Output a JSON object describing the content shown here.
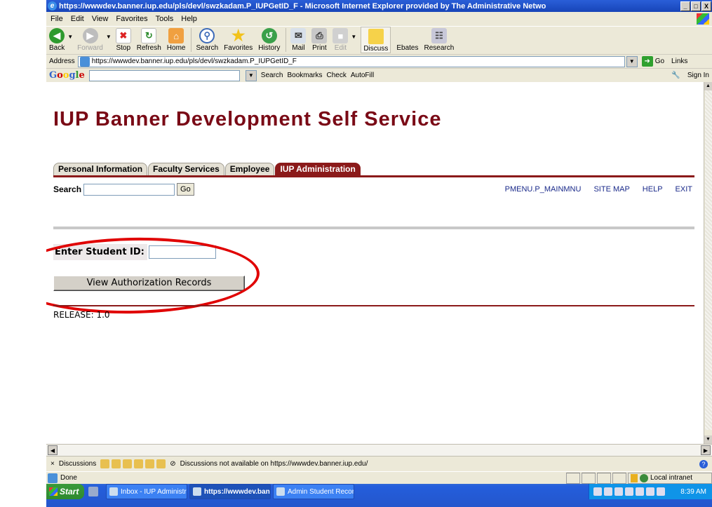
{
  "window": {
    "title": "https://wwwdev.banner.iup.edu/pls/devl/swzkadam.P_IUPGetID_F - Microsoft Internet Explorer provided by The Administrative Netwo",
    "min": "_",
    "max": "□",
    "close": "X"
  },
  "menu": [
    "File",
    "Edit",
    "View",
    "Favorites",
    "Tools",
    "Help"
  ],
  "toolbar": {
    "back": "Back",
    "forward": "Forward",
    "stop": "Stop",
    "refresh": "Refresh",
    "home": "Home",
    "search": "Search",
    "favorites": "Favorites",
    "history": "History",
    "mail": "Mail",
    "print": "Print",
    "edit": "Edit",
    "discuss": "Discuss",
    "ebates": "Ebates",
    "research": "Research"
  },
  "address": {
    "label": "Address",
    "url": "https://wwwdev.banner.iup.edu/pls/devl/swzkadam.P_IUPGetID_F",
    "go": "Go",
    "links": "Links"
  },
  "google": {
    "search": "Search",
    "bookmarks": "Bookmarks",
    "check": "Check",
    "autofill": "AutoFill",
    "sign_in": "Sign In"
  },
  "page": {
    "title": "IUP Banner Development Self Service",
    "tabs": [
      {
        "label": "Personal Information",
        "active": false
      },
      {
        "label": "Faculty Services",
        "active": false
      },
      {
        "label": "Employee",
        "active": false
      },
      {
        "label": "IUP Administration",
        "active": true
      }
    ],
    "search_label": "Search",
    "search_value": "",
    "go_label": "Go",
    "top_links": [
      "PMENU.P_MAINMNU",
      "SITE MAP",
      "HELP",
      "EXIT"
    ],
    "student_id_label": "Enter Student ID:",
    "student_id_value": "",
    "view_button": "View Authorization Records",
    "release": "RELEASE: 1.0"
  },
  "discussions": {
    "close": "×",
    "label": "Discussions",
    "message": "Discussions not available on https://wwwdev.banner.iup.edu/"
  },
  "status": {
    "text": "Done",
    "zone": "Local intranet"
  },
  "taskbar": {
    "start": "Start",
    "tasks": [
      {
        "label": "Inbox - IUP Administrativ...",
        "active": false
      },
      {
        "label": "https://wwwdev.ban...",
        "active": true
      },
      {
        "label": "Admin Student Record R...",
        "active": false
      }
    ],
    "clock": "8:39 AM"
  },
  "colors": {
    "brand": "#7a0a16",
    "active_tab": "#8b1a1a",
    "annotation": "#e00000"
  }
}
